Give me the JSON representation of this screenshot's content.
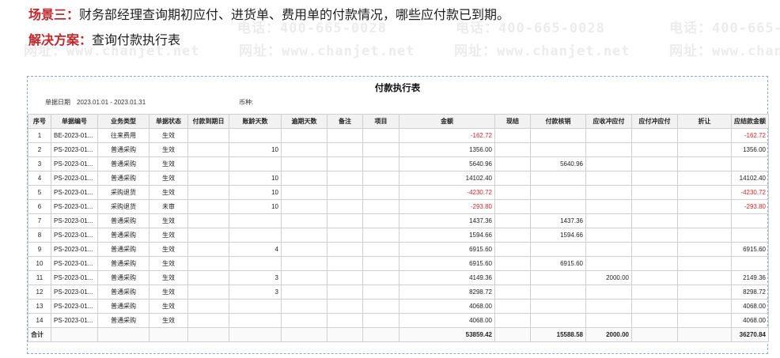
{
  "heading": {
    "line1_label": "场景三：",
    "line1_text": "财务部经理查询期初应付、进货单、费用单的付款情况，哪些应付款已到期。",
    "line2_label": "解决方案：",
    "line2_text": "查询付款执行表"
  },
  "watermark": {
    "phone": "电话：400-665-0028",
    "site": "网址：www.chanjet.net"
  },
  "report": {
    "title": "付款执行表",
    "date_label": "单据日期",
    "date_range": "2023.01.01 - 2023.01.31",
    "currency_label": "币种:",
    "currency_value": ""
  },
  "columns": [
    "序号",
    "单据编号",
    "业务类型",
    "单据状态",
    "付款到期日",
    "账龄天数",
    "逾期天数",
    "备注",
    "项目",
    "金额",
    "现结",
    "付款核销",
    "应收冲应付",
    "应付冲应付",
    "折让",
    "应结款金额"
  ],
  "rows": [
    [
      "1",
      "BE-2023-01...",
      "往来费用",
      "生效",
      "",
      "",
      "",
      "",
      "",
      "-162.72",
      "",
      "",
      "",
      "",
      "",
      "-162.72"
    ],
    [
      "2",
      "PS-2023-01...",
      "普通采购",
      "生效",
      "",
      "10",
      "",
      "",
      "",
      "1356.00",
      "",
      "",
      "",
      "",
      "",
      "1356.00"
    ],
    [
      "3",
      "PS-2023-01...",
      "普通采购",
      "生效",
      "",
      "",
      "",
      "",
      "",
      "5640.96",
      "",
      "5640.96",
      "",
      "",
      "",
      ""
    ],
    [
      "4",
      "PS-2023-01...",
      "普通采购",
      "生效",
      "",
      "10",
      "",
      "",
      "",
      "14102.40",
      "",
      "",
      "",
      "",
      "",
      "14102.40"
    ],
    [
      "5",
      "PS-2023-01...",
      "采购退货",
      "生效",
      "",
      "10",
      "",
      "",
      "",
      "-4230.72",
      "",
      "",
      "",
      "",
      "",
      "-4230.72"
    ],
    [
      "6",
      "PS-2023-01...",
      "采购退货",
      "未审",
      "",
      "10",
      "",
      "",
      "",
      "-293.80",
      "",
      "",
      "",
      "",
      "",
      "-293.80"
    ],
    [
      "7",
      "PS-2023-01...",
      "普通采购",
      "生效",
      "",
      "",
      "",
      "",
      "",
      "1437.36",
      "",
      "1437.36",
      "",
      "",
      "",
      ""
    ],
    [
      "8",
      "PS-2023-01...",
      "普通采购",
      "生效",
      "",
      "",
      "",
      "",
      "",
      "1594.66",
      "",
      "1594.66",
      "",
      "",
      "",
      ""
    ],
    [
      "9",
      "PS-2023-01...",
      "普通采购",
      "生效",
      "",
      "4",
      "",
      "",
      "",
      "6915.60",
      "",
      "",
      "",
      "",
      "",
      "6915.60"
    ],
    [
      "10",
      "PS-2023-01...",
      "普通采购",
      "生效",
      "",
      "",
      "",
      "",
      "",
      "6915.60",
      "",
      "6915.60",
      "",
      "",
      "",
      ""
    ],
    [
      "11",
      "PS-2023-01...",
      "普通采购",
      "生效",
      "",
      "3",
      "",
      "",
      "",
      "4149.36",
      "",
      "",
      "2000.00",
      "",
      "",
      "2149.36"
    ],
    [
      "12",
      "PS-2023-01...",
      "普通采购",
      "生效",
      "",
      "3",
      "",
      "",
      "",
      "8298.72",
      "",
      "",
      "",
      "",
      "",
      "8298.72"
    ],
    [
      "13",
      "PS-2023-01...",
      "普通采购",
      "生效",
      "",
      "",
      "",
      "",
      "",
      "4068.00",
      "",
      "",
      "",
      "",
      "",
      "4068.00"
    ],
    [
      "14",
      "PS-2023-01...",
      "普通采购",
      "生效",
      "",
      "",
      "",
      "",
      "",
      "4068.00",
      "",
      "",
      "",
      "",
      "",
      "4068.00"
    ]
  ],
  "totals": [
    "合计",
    "",
    "",
    "",
    "",
    "",
    "",
    "",
    "",
    "53859.42",
    "",
    "15588.58",
    "2000.00",
    "",
    "",
    "36270.84"
  ],
  "colors": {
    "accent_red": "#c0282d",
    "negative_red": "#d0282d",
    "border_blue": "#8fa6c7"
  }
}
